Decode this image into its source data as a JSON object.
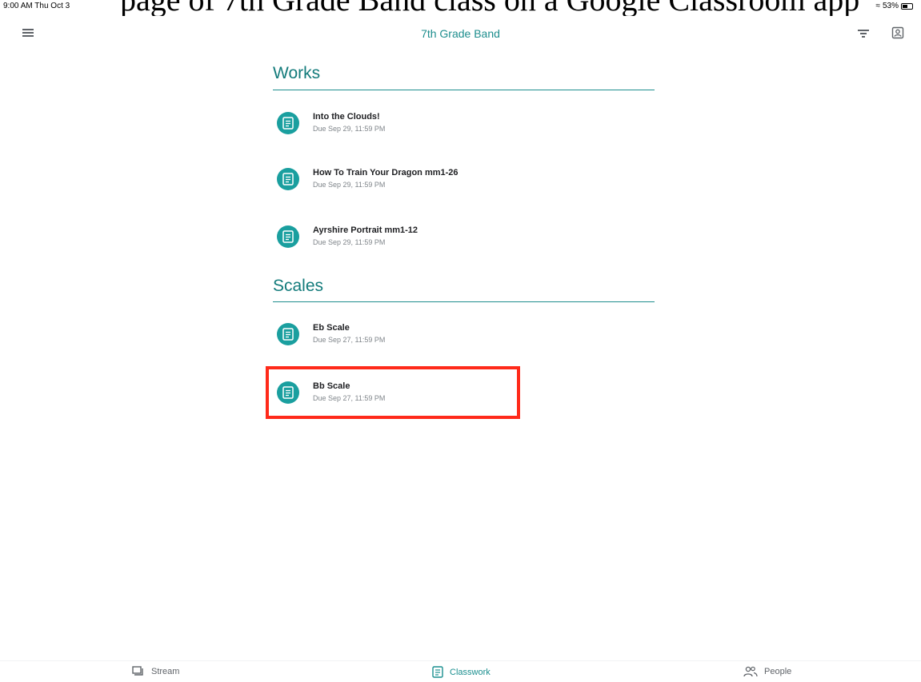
{
  "header_overlay": "page of 7th Grade Band class on a Google Classroom app",
  "status_bar": {
    "time_date": "9:00 AM  Thu Oct 3",
    "battery": "53%"
  },
  "app": {
    "title": "7th Grade Band"
  },
  "icons": {
    "menu": "hamburger-menu-icon",
    "filter": "filter-icon",
    "profile": "student-profile-icon",
    "assignment": "assignment-icon"
  },
  "sections": [
    {
      "title": "Works",
      "items": [
        {
          "title": "Into the Clouds!",
          "due": "Due Sep 29, 11:59 PM"
        },
        {
          "title": "How To Train Your Dragon mm1-26",
          "due": "Due Sep 29, 11:59 PM"
        },
        {
          "title": "Ayrshire Portrait mm1-12",
          "due": "Due Sep 29, 11:59 PM"
        }
      ]
    },
    {
      "title": "Scales",
      "items": [
        {
          "title": "Eb Scale",
          "due": "Due Sep 27, 11:59 PM"
        },
        {
          "title": "Bb Scale",
          "due": "Due Sep 27, 11:59 PM"
        }
      ]
    }
  ],
  "bottom_nav": [
    {
      "label": "Stream",
      "icon": "stream-icon"
    },
    {
      "label": "Classwork",
      "icon": "classwork-icon",
      "active": true
    },
    {
      "label": "People",
      "icon": "people-icon"
    }
  ],
  "colors": {
    "accent": "#1a9f9f",
    "highlight": "#ff2a1a"
  }
}
